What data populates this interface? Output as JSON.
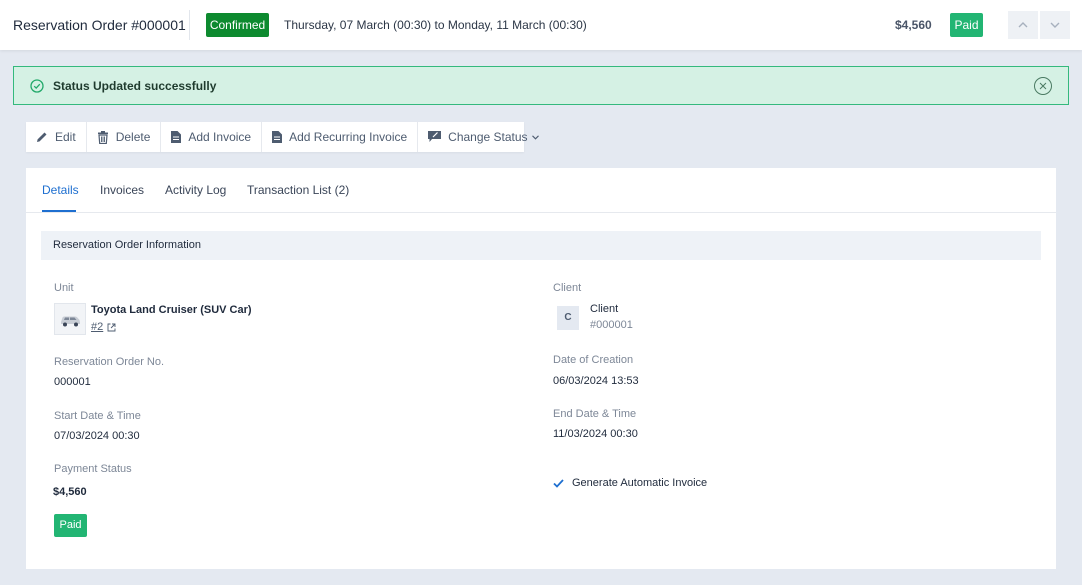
{
  "header": {
    "title": "Reservation Order #000001",
    "status": "Confirmed",
    "date_range": "Thursday, 07 March (00:30) to Monday, 11 March (00:30)",
    "amount": "$4,560",
    "payment_badge": "Paid",
    "prev_icon": "chevron-up",
    "next_icon": "chevron-down"
  },
  "alert": {
    "message": "Status Updated successfully",
    "icon": "check-circle",
    "color": "#34b97d"
  },
  "toolbar": {
    "edit": "Edit",
    "delete": "Delete",
    "add_invoice": "Add Invoice",
    "add_recurring_invoice": "Add Recurring Invoice",
    "change_status": "Change Status"
  },
  "tabs": [
    "Details",
    "Invoices",
    "Activity Log",
    "Transaction List (2)"
  ],
  "section": {
    "title": "Reservation Order Information"
  },
  "fields": {
    "unit_label": "Unit",
    "unit_name": "Toyota Land Cruiser (SUV Car)",
    "unit_link": "#2",
    "client_label": "Client",
    "client_initial": "C",
    "client_name": "Client",
    "client_id": "#000001",
    "order_no_label": "Reservation Order No.",
    "order_no": "000001",
    "created_label": "Date of Creation",
    "created": "06/03/2024 13:53",
    "start_label": "Start Date & Time",
    "start": "07/03/2024 00:30",
    "end_label": "End Date & Time",
    "end": "11/03/2024 00:30",
    "payment_label": "Payment Status",
    "payment_amount": "$4,560",
    "payment_badge": "Paid",
    "auto_invoice": "Generate Automatic Invoice"
  },
  "colors": {
    "confirmed": "#0d8a2f",
    "paid": "#22b573",
    "accent": "#1e6fd0"
  }
}
